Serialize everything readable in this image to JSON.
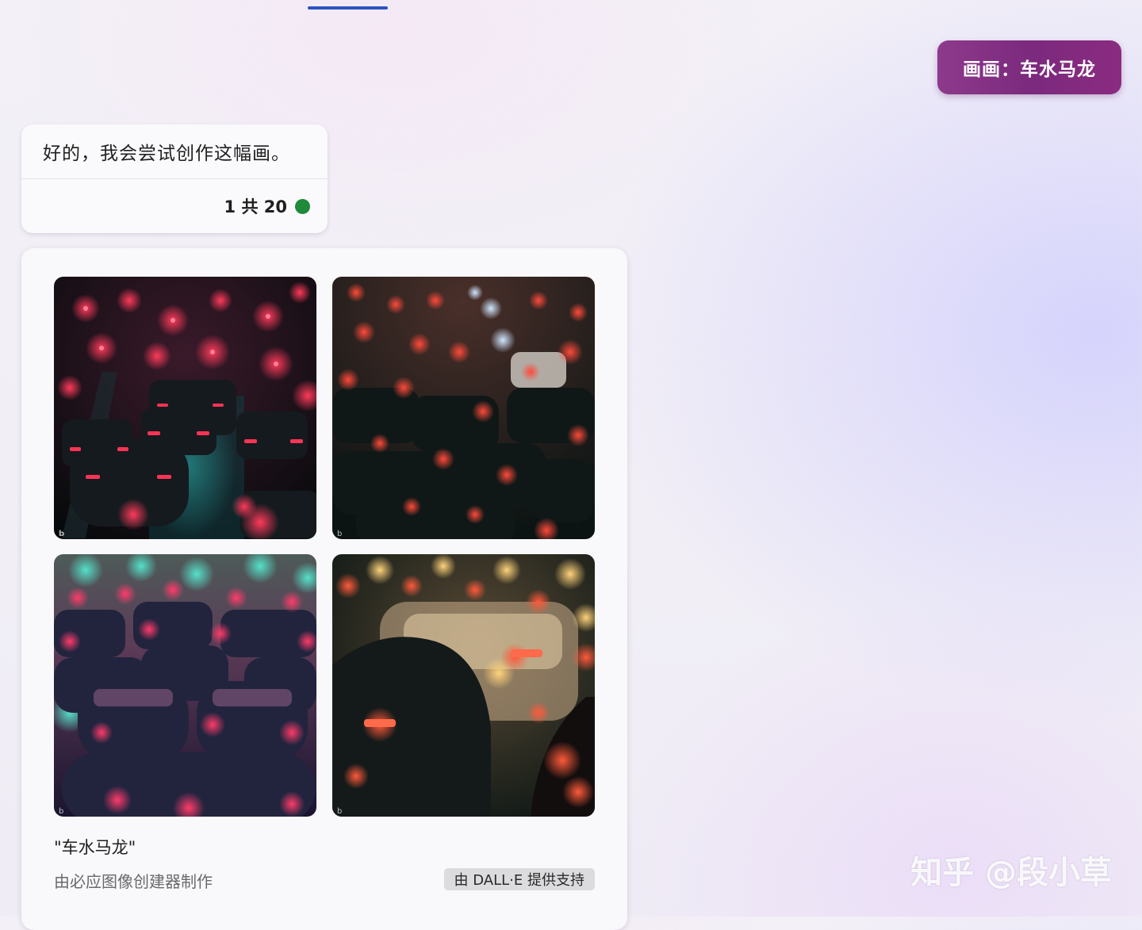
{
  "colors": {
    "accent_tab": "#2a55c4",
    "user_bubble": "#8a2f86",
    "status_dot": "#1f8a3a"
  },
  "user_message": {
    "text": "画画：车水马龙"
  },
  "bot_message": {
    "text": "好的，我会尝试创作这幅画。",
    "turn_counter": "1 共 20",
    "status_icon": "green-status-dot"
  },
  "image_result": {
    "images": [
      {
        "alt_icon": "bing-logo",
        "scene": "traffic-night-pink"
      },
      {
        "alt_icon": "bing-logo",
        "scene": "traffic-night-dark"
      },
      {
        "alt_icon": "bing-logo",
        "scene": "traffic-night-purple"
      },
      {
        "alt_icon": "bing-logo",
        "scene": "traffic-night-warm"
      }
    ],
    "caption": "\"车水马龙\"",
    "credit": "由必应图像创建器制作",
    "powered_by": "由 DALL·E 提供支持",
    "bing_mark": "b"
  },
  "watermark": {
    "text": "知乎 @段小草"
  }
}
